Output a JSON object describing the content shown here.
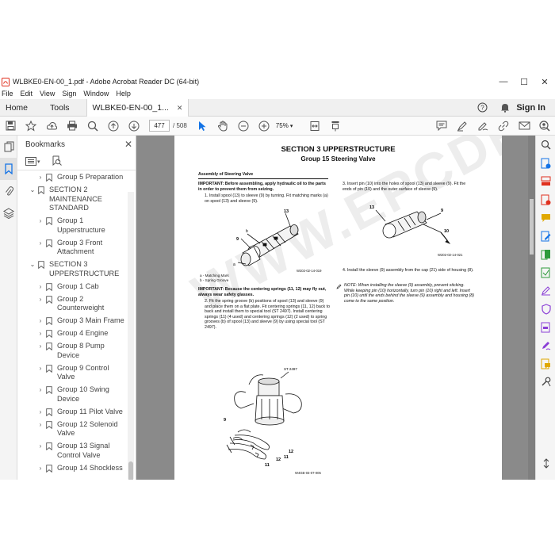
{
  "window": {
    "title": "WLBKE0-EN-00_1.pdf - Adobe Acrobat Reader DC (64-bit)",
    "minimize": "—",
    "maximize": "☐",
    "close": "✕"
  },
  "menu": [
    "File",
    "Edit",
    "View",
    "Sign",
    "Window",
    "Help"
  ],
  "tabs": {
    "home": "Home",
    "tools": "Tools",
    "document": "WLBKE0-EN-00_1...",
    "document_close": "✕",
    "sign_in": "Sign In"
  },
  "toolbar": {
    "page_current": "477",
    "page_total": "/ 508",
    "zoom": "75%"
  },
  "bookmarks": {
    "title": "Bookmarks",
    "close": "✕",
    "items": [
      {
        "label": "Group 5 Preparation",
        "level": 1,
        "caret": "›"
      },
      {
        "label": "SECTION 2 MAINTENANCE STANDARD",
        "level": 0,
        "caret": "⌄"
      },
      {
        "label": "Group 1 Upperstructure",
        "level": 1,
        "caret": "›"
      },
      {
        "label": "Group 3 Front Attachment",
        "level": 1,
        "caret": "›"
      },
      {
        "label": "SECTION 3 UPPERSTRUCTURE",
        "level": 0,
        "caret": "⌄"
      },
      {
        "label": "Group 1 Cab",
        "level": 1,
        "caret": "›"
      },
      {
        "label": "Group 2 Counterweight",
        "level": 1,
        "caret": "›"
      },
      {
        "label": "Group 3 Main Frame",
        "level": 1,
        "caret": "›"
      },
      {
        "label": "Group 4 Engine",
        "level": 1,
        "caret": "›"
      },
      {
        "label": "Group 8 Pump Device",
        "level": 1,
        "caret": "›"
      },
      {
        "label": "Group 9 Control Valve",
        "level": 1,
        "caret": "›"
      },
      {
        "label": "Group 10 Swing Device",
        "level": 1,
        "caret": "›"
      },
      {
        "label": "Group 11 Pilot Valve",
        "level": 1,
        "caret": "›"
      },
      {
        "label": "Group 12 Solenoid Valve",
        "level": 1,
        "caret": "›"
      },
      {
        "label": "Group 13 Signal Control Valve",
        "level": 1,
        "caret": "›"
      },
      {
        "label": "Group 14 Shockless",
        "level": 1,
        "caret": "›"
      }
    ]
  },
  "page": {
    "watermark": "WWW.EPCDEPOT.COM",
    "section_title": "SECTION 3 UPPERSTRUCTURE",
    "group_title": "Group 15 Steering Valve",
    "subhead": "Assembly of Steering Valve",
    "important1": "IMPORTANT:  Before assembling, apply hydraulic oil to the parts in order to prevent them from seizing.",
    "step1": "1.  Install spool (13) to sleeve (9) by turning. Fit matching marks (a) on spool (13) and sleeve (9).",
    "fig1_code": "W202-02-14-019",
    "fig1_legend_a": "a -   Matching Mark",
    "fig1_legend_b": "b -   Spring Groove",
    "fig1_labels": [
      "b",
      "13",
      "9",
      "a"
    ],
    "important2": "IMPORTANT:  Because the centering springs (11, 12) may fly out, always wear safety glasses.",
    "step2": "2.  Fit the spring groove (b) positions of spool (13) and sleeve (9) and place them on a flat plate. Fit centering springs (11, 12) back to back and install them to special tool (ST 2497). Install centering springs (11) (4 used) and centering springs (12) (2 used) to spring grooves (b) of spool (13) and sleeve (9) by using special tool (ST 2497).",
    "fig2_code": "W4GB-03-07-005",
    "fig2_labels": [
      "ST 2497",
      "9",
      "12",
      "11",
      "12",
      "11"
    ],
    "step3": "3.  Insert pin (10) into the holes of spool (13) and sleeve (9). Fit the ends of pin (10) and the outer surface of sleeve (9).",
    "fig3_code": "W202-02-14-021",
    "fig3_labels": [
      "9",
      "13",
      "10"
    ],
    "step4": "4.  Install the sleeve (9) assembly from the cap (21) side of housing (8).",
    "note": "NOTE:  When installing the sleeve (9) assembly, prevent sticking. While keeping pin (10) horizontally, turn pin (10) right and left. Insert pin (10) until the ends behind the sleeve (9) assembly and housing (8) come to the same position."
  },
  "colors": {
    "accent": "#1473e6",
    "pdf_red": "#e0301e",
    "tool_purple": "#8b3fd6",
    "tool_green": "#2e9b3c",
    "tool_yellow": "#e0a800"
  }
}
